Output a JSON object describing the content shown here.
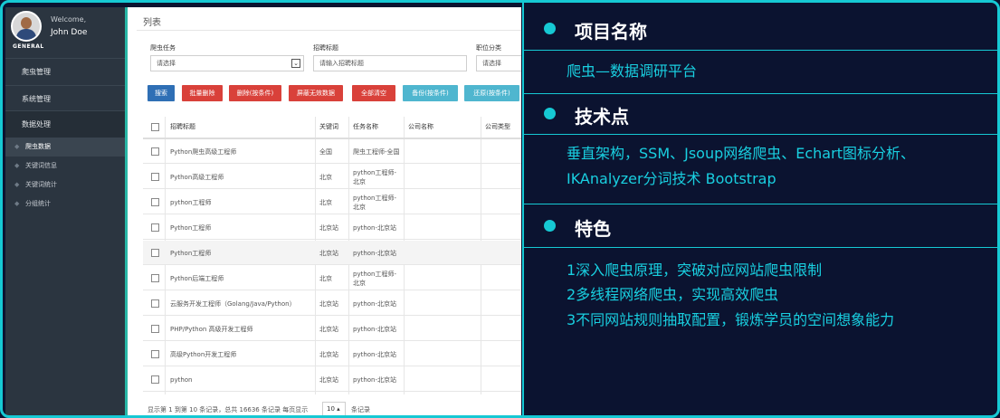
{
  "sidebar": {
    "welcome": "Welcome,",
    "username": "John Doe",
    "section": "GENERAL",
    "menu": [
      "爬虫管理",
      "系统管理",
      "数据处理"
    ],
    "submenu": [
      "爬虫数据",
      "关键词信息",
      "关键词统计",
      "分组统计"
    ]
  },
  "main": {
    "title": "列表",
    "filters": [
      {
        "label": "爬虫任务",
        "value": "请选择"
      },
      {
        "label": "招聘标题",
        "placeholder": "请输入招聘标题"
      },
      {
        "label": "职位分类",
        "value": "请选择"
      }
    ],
    "buttons": [
      "搜索",
      "批量删除",
      "删除(按条件)",
      "屏蔽无效数据",
      "全部清空",
      "备份(按条件)",
      "还原(按条件)"
    ],
    "columns": [
      "招聘标题",
      "关键词",
      "任务名称",
      "公司名称",
      "公司类型"
    ],
    "rows": [
      {
        "title": "Python爬虫高级工程师",
        "keyword": "全国",
        "task": "爬虫工程师-全国"
      },
      {
        "title": "Python高级工程师",
        "keyword": "北京",
        "task": "python工程师-北京"
      },
      {
        "title": "python工程师",
        "keyword": "北京",
        "task": "python工程师-北京"
      },
      {
        "title": "Python工程师",
        "keyword": "北京站",
        "task": "python-北京站"
      },
      {
        "title": "Python工程师",
        "keyword": "北京站",
        "task": "python-北京站"
      },
      {
        "title": "Python后端工程师",
        "keyword": "北京",
        "task": "python工程师-北京"
      },
      {
        "title": "云服务开发工程师（Golang/Java/Python）",
        "keyword": "北京站",
        "task": "python-北京站"
      },
      {
        "title": "PHP/Python 高级开发工程师",
        "keyword": "北京站",
        "task": "python-北京站"
      },
      {
        "title": "高级Python开发工程师",
        "keyword": "北京站",
        "task": "python-北京站"
      },
      {
        "title": "python",
        "keyword": "北京站",
        "task": "python-北京站"
      }
    ],
    "footer": "显示第 1 到第 10 条记录，总共 16636 条记录 每页显示",
    "page_size": "10 ▴",
    "footer_suffix": "条记录"
  },
  "info": {
    "sections": [
      {
        "title": "项目名称",
        "lines": [
          "爬虫—数据调研平台"
        ]
      },
      {
        "title": "技术点",
        "lines": [
          "垂直架构，SSM、Jsoup网络爬虫、Echart图标分析、",
          "IKAnalyzer分词技术 Bootstrap"
        ]
      },
      {
        "title": "特色",
        "lines": [
          "1深入爬虫原理，突破对应网站爬虫限制",
          "2多线程网络爬虫，实现高效爬虫",
          "3不同网站规则抽取配置，锻炼学员的空间想象能力"
        ]
      }
    ]
  },
  "colors": {
    "accent": "#16c9d4",
    "background": "#0b1330",
    "sidebar": "#2b3540",
    "btn_blue": "#2f6fb5",
    "btn_red": "#d9413a",
    "btn_cyan": "#4fb6cf"
  }
}
